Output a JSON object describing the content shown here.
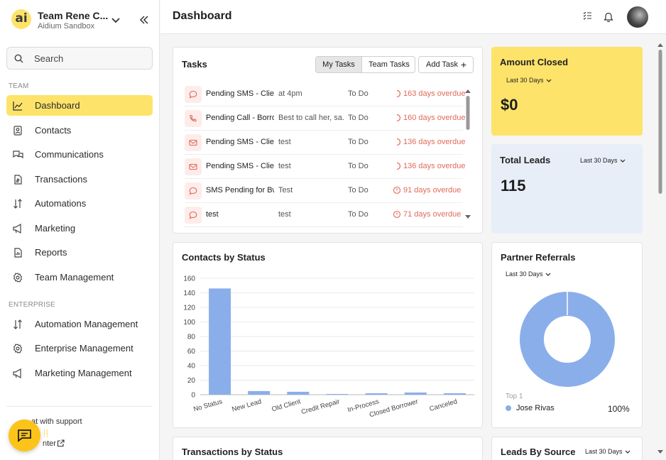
{
  "brand": {
    "title": "Team Rene C...",
    "subtitle": "Aidium Sandbox",
    "logo_text": "ai"
  },
  "search": {
    "placeholder": "Search"
  },
  "sidebar": {
    "team_label": "TEAM",
    "enterprise_label": "ENTERPRISE",
    "team_items": [
      {
        "label": "Dashboard",
        "icon": "chart-line-icon",
        "active": true
      },
      {
        "label": "Contacts",
        "icon": "contacts-icon"
      },
      {
        "label": "Communications",
        "icon": "chat-bubbles-icon"
      },
      {
        "label": "Transactions",
        "icon": "document-dollar-icon"
      },
      {
        "label": "Automations",
        "icon": "automation-sort-icon"
      },
      {
        "label": "Marketing",
        "icon": "megaphone-icon"
      },
      {
        "label": "Reports",
        "icon": "report-icon"
      },
      {
        "label": "Team Management",
        "icon": "gear-icon"
      }
    ],
    "enterprise_items": [
      {
        "label": "Automation Management",
        "icon": "automation-sort-icon"
      },
      {
        "label": "Enterprise Management",
        "icon": "gear-icon"
      },
      {
        "label": "Marketing Management",
        "icon": "megaphone-icon"
      }
    ],
    "support_line1": "Chat with support",
    "support_line2": "Help Center",
    "support_visible1": "at with support",
    "support_visible2": "nter"
  },
  "header": {
    "title": "Dashboard"
  },
  "tasks": {
    "title": "Tasks",
    "tab_my": "My Tasks",
    "tab_team": "Team Tasks",
    "add_label": "Add Task",
    "rows": [
      {
        "type": "sms",
        "name": "Pending SMS - Client",
        "note": "at 4pm",
        "status": "To Do",
        "due": "163 days overdue",
        "due_icon": "partial-circle-icon"
      },
      {
        "type": "call",
        "name": "Pending Call - Borrower",
        "note": "Best to call her, sa...",
        "status": "To Do",
        "due": "160 days overdue",
        "due_icon": "partial-circle-icon"
      },
      {
        "type": "email",
        "name": "Pending SMS - Client",
        "note": "test",
        "status": "To Do",
        "due": "136 days overdue",
        "due_icon": "partial-circle-icon"
      },
      {
        "type": "email",
        "name": "Pending SMS - Client",
        "note": "test",
        "status": "To Do",
        "due": "136 days overdue",
        "due_icon": "partial-circle-icon"
      },
      {
        "type": "sms",
        "name": "SMS Pending for Bw",
        "note": "Test",
        "status": "To Do",
        "due": "91 days overdue",
        "due_icon": "clock-alert-icon"
      },
      {
        "type": "sms",
        "name": "test",
        "note": "test",
        "status": "To Do",
        "due": "71 days overdue",
        "due_icon": "clock-alert-icon"
      }
    ]
  },
  "amount_closed": {
    "title": "Amount Closed",
    "range": "Last 30 Days",
    "value": "$0"
  },
  "total_leads": {
    "title": "Total Leads",
    "range": "Last 30 Days",
    "value": "115"
  },
  "contacts_status": {
    "title": "Contacts by Status"
  },
  "partner_referrals": {
    "title": "Partner Referrals",
    "range": "Last 30 Days",
    "top_label": "Top 1",
    "legend_name": "Jose Rivas",
    "legend_pct": "100%"
  },
  "transactions_status": {
    "title": "Transactions by Status"
  },
  "leads_source": {
    "title": "Leads By Source",
    "range": "Last 30 Days"
  },
  "colors": {
    "accent": "#fde36a",
    "bar": "#8aaeea",
    "overdue": "#e06a5a",
    "leads_bg": "#e8eef8"
  },
  "chart_data": [
    {
      "type": "bar",
      "title": "Contacts by Status",
      "categories": [
        "No Status",
        "New Lead",
        "Old Client",
        "Credit Repair",
        "In-Process",
        "Closed Borrower",
        "Canceled"
      ],
      "values": [
        146,
        5,
        4,
        1,
        2,
        3,
        2
      ],
      "yticks": [
        0,
        20,
        40,
        60,
        80,
        100,
        120,
        140,
        160
      ],
      "ylim": [
        0,
        160
      ],
      "grid": true
    },
    {
      "type": "pie",
      "title": "Partner Referrals",
      "categories": [
        "Jose Rivas"
      ],
      "values": [
        100
      ],
      "donut": true
    }
  ]
}
